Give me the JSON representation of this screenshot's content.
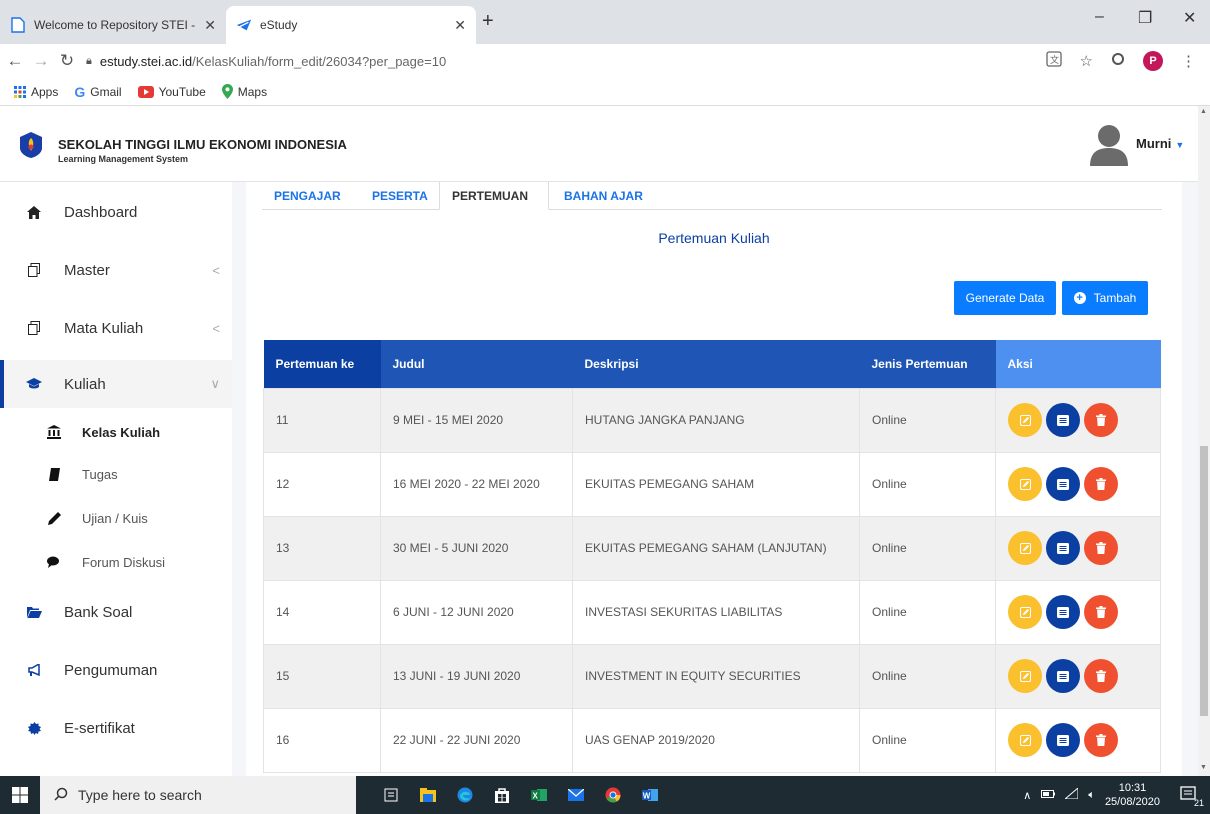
{
  "browser": {
    "tabs": [
      {
        "title": "Welcome to Repository STEI - Re",
        "active": false
      },
      {
        "title": "eStudy",
        "active": true
      }
    ],
    "url_host": "estudy.stei.ac.id",
    "url_path": "/KelasKuliah/form_edit/26034?per_page=10",
    "profile_initial": "P",
    "bookmarks": [
      "Apps",
      "Gmail",
      "YouTube",
      "Maps"
    ]
  },
  "header": {
    "institution": "SEKOLAH TINGGI ILMU EKONOMI INDONESIA",
    "subtitle": "Learning Management System",
    "user_name": "Murni"
  },
  "sidebar": {
    "items": [
      {
        "label": "Dashboard",
        "icon": "home-icon"
      },
      {
        "label": "Master",
        "icon": "copy-icon"
      },
      {
        "label": "Mata Kuliah",
        "icon": "copy-icon"
      },
      {
        "label": "Kuliah",
        "icon": "graduation-cap-icon"
      },
      {
        "label": "Bank Soal",
        "icon": "folder-open-icon"
      },
      {
        "label": "Pengumuman",
        "icon": "bullhorn-icon"
      },
      {
        "label": "E-sertifikat",
        "icon": "certificate-icon"
      }
    ],
    "sub_items": [
      {
        "label": "Kelas Kuliah",
        "icon": "university-icon"
      },
      {
        "label": "Tugas",
        "icon": "book-icon"
      },
      {
        "label": "Ujian / Kuis",
        "icon": "pencil-icon"
      },
      {
        "label": "Forum Diskusi",
        "icon": "comments-icon"
      }
    ]
  },
  "main": {
    "tabs": [
      "PENGAJAR",
      "PESERTA",
      "PERTEMUAN",
      "BAHAN AJAR"
    ],
    "active_tab": "PERTEMUAN",
    "section_title": "Pertemuan Kuliah",
    "generate_label": "Generate Data",
    "add_label": "Tambah",
    "columns": [
      "Pertemuan ke",
      "Judul",
      "Deskripsi",
      "Jenis Pertemuan",
      "Aksi"
    ],
    "rows": [
      {
        "no": "11",
        "judul": "9 MEI - 15 MEI 2020",
        "deskripsi": "HUTANG JANGKA PANJANG",
        "jenis": "Online"
      },
      {
        "no": "12",
        "judul": "16 MEI 2020 - 22 MEI 2020",
        "deskripsi": "EKUITAS PEMEGANG SAHAM",
        "jenis": "Online"
      },
      {
        "no": "13",
        "judul": "30 MEI - 5 JUNI 2020",
        "deskripsi": "EKUITAS PEMEGANG SAHAM (LANJUTAN)",
        "jenis": "Online"
      },
      {
        "no": "14",
        "judul": "6 JUNI - 12 JUNI 2020",
        "deskripsi": "INVESTASI SEKURITAS LIABILITAS",
        "jenis": "Online"
      },
      {
        "no": "15",
        "judul": "13 JUNI - 19 JUNI 2020",
        "deskripsi": "INVESTMENT IN EQUITY SECURITIES",
        "jenis": "Online"
      },
      {
        "no": "16",
        "judul": "22 JUNI - 22 JUNI 2020",
        "deskripsi": "UAS GENAP 2019/2020",
        "jenis": "Online"
      }
    ]
  },
  "taskbar": {
    "search_placeholder": "Type here to search",
    "time": "10:31",
    "date": "25/08/2020",
    "notifications": "21"
  },
  "colors": {
    "primary_dark": "#0b3fa2",
    "primary": "#0a7cff",
    "edit": "#fbc02d",
    "delete": "#ef5130"
  }
}
